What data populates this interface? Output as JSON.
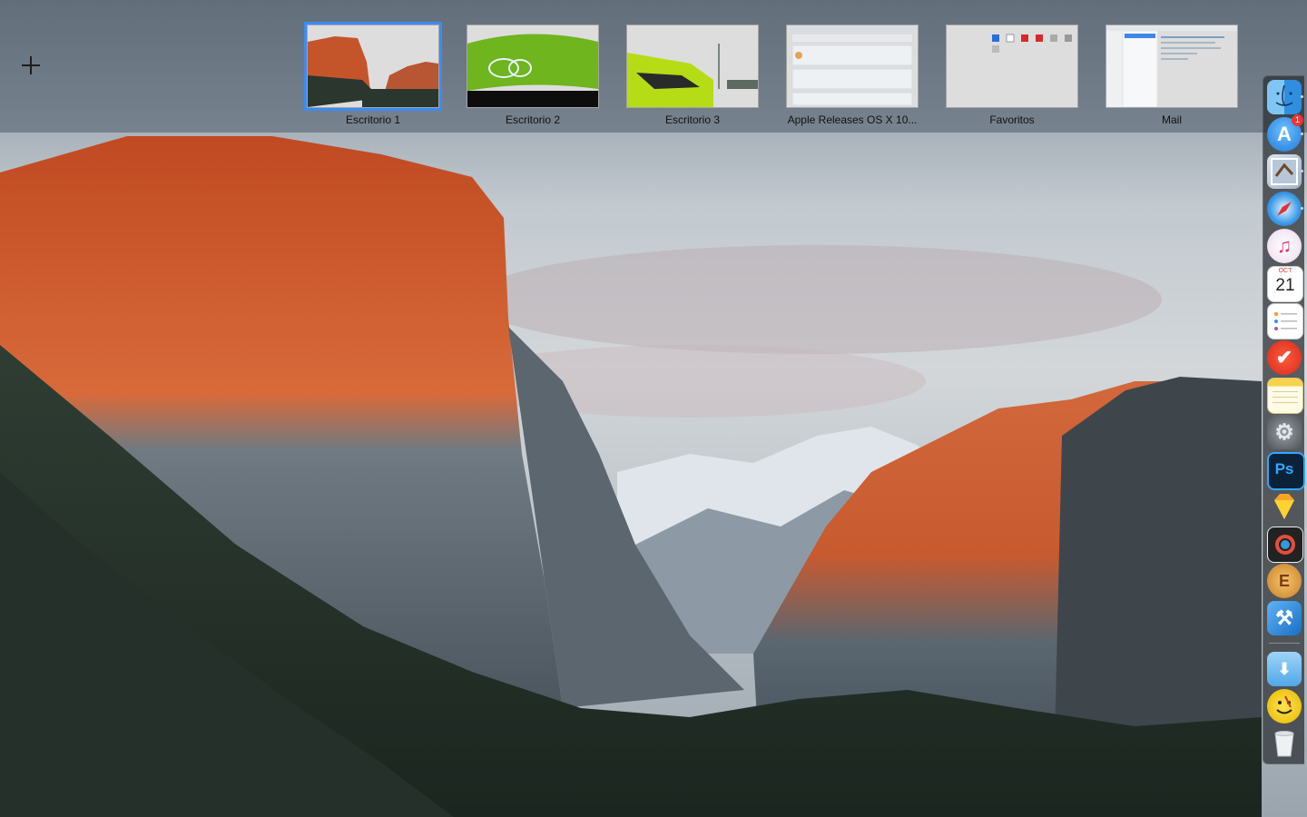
{
  "spaces": {
    "add_label": "+",
    "items": [
      {
        "label": "Escritorio 1",
        "active": true
      },
      {
        "label": "Escritorio 2",
        "active": false
      },
      {
        "label": "Escritorio 3",
        "active": false
      },
      {
        "label": "Apple Releases OS X 10...",
        "active": false
      },
      {
        "label": "Favoritos",
        "active": false
      },
      {
        "label": "Mail",
        "active": false
      }
    ]
  },
  "dock": {
    "items": [
      {
        "name": "finder-icon",
        "running": true
      },
      {
        "name": "app-store-icon",
        "running": true,
        "badge": "1"
      },
      {
        "name": "mail-icon",
        "running": true
      },
      {
        "name": "safari-icon",
        "running": true
      },
      {
        "name": "itunes-icon",
        "running": false
      },
      {
        "name": "calendar-icon",
        "running": false,
        "month": "OCT",
        "day": "21"
      },
      {
        "name": "reminders-icon",
        "running": false
      },
      {
        "name": "wunderlist-icon",
        "running": false
      },
      {
        "name": "notes-icon",
        "running": false
      },
      {
        "name": "system-preferences-icon",
        "running": false
      },
      {
        "name": "photoshop-icon",
        "running": false,
        "text": "Ps"
      },
      {
        "name": "sketch-icon",
        "running": false
      },
      {
        "name": "color-picker-icon",
        "running": false
      },
      {
        "name": "espresso-icon",
        "running": false,
        "text": "E"
      },
      {
        "name": "xcode-icon",
        "running": false
      },
      {
        "name": "downloads-folder-icon",
        "running": false
      },
      {
        "name": "watchmen-icon",
        "running": false
      },
      {
        "name": "trash-icon",
        "running": false
      }
    ]
  },
  "colors": {
    "accent": "#3b8cf5",
    "badge": "#e33333"
  }
}
